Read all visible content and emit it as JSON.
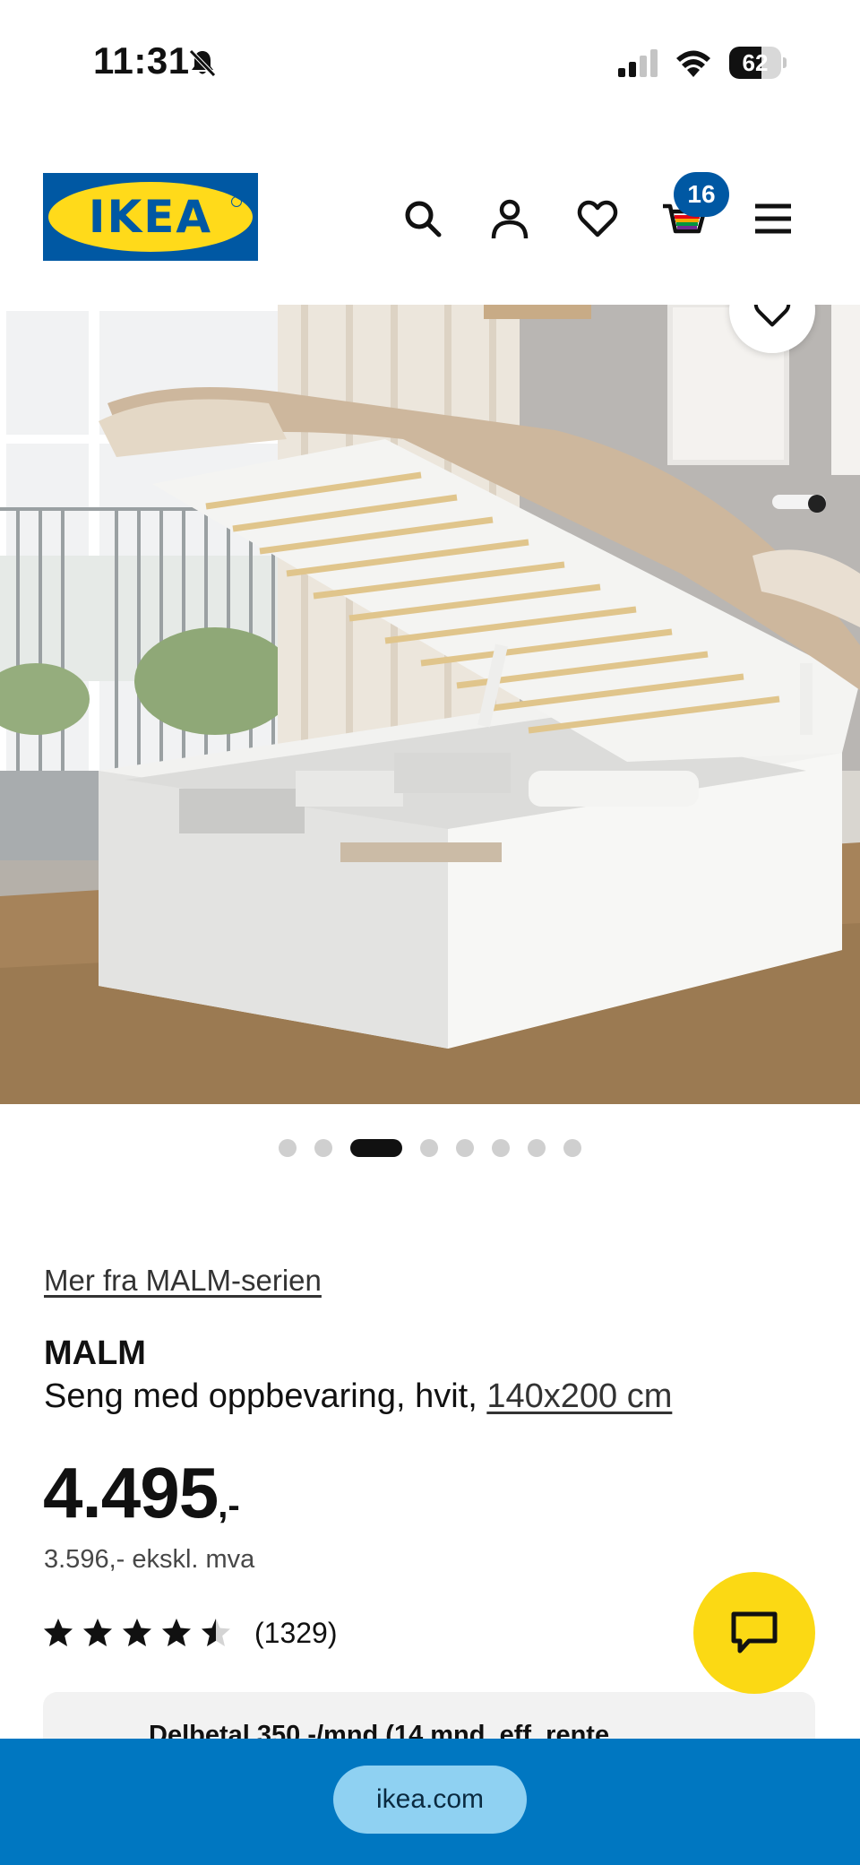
{
  "status_bar": {
    "time": "11:31",
    "battery_percent": "62",
    "battery_level": 0.62,
    "icons": [
      "bell-muted-icon",
      "cellular-signal-icon",
      "wifi-icon",
      "battery-icon"
    ]
  },
  "header": {
    "logo_text": "IKEA",
    "icons": [
      "search-icon",
      "account-icon",
      "heart-icon",
      "cart-icon",
      "menu-icon"
    ],
    "cart_count": "16"
  },
  "gallery": {
    "image_count": 8,
    "active_index": 2,
    "favorite_icon": "heart-icon"
  },
  "product": {
    "series_link": "Mer fra MALM-serien",
    "name": "MALM",
    "description": "Seng med oppbevaring, hvit, ",
    "size_link": "140x200 cm",
    "price": "4.495",
    "price_suffix": ",-",
    "price_ex_vat": "3.596,- ekskl. mva",
    "rating_value": 4.5,
    "rating_max": 5,
    "review_count": "(1329)",
    "financing_text": "Delbetal 350,-/mnd (14 mnd. eff. rente"
  },
  "chat": {
    "icon": "chat-bubble-icon"
  },
  "browser": {
    "url": "ikea.com"
  },
  "colors": {
    "ikea_blue": "#0058a3",
    "ikea_yellow": "#ffda1a",
    "chat_yellow": "#fbd914",
    "bottom_bar_blue": "#0077c1",
    "url_pill": "#8fd1f2"
  }
}
